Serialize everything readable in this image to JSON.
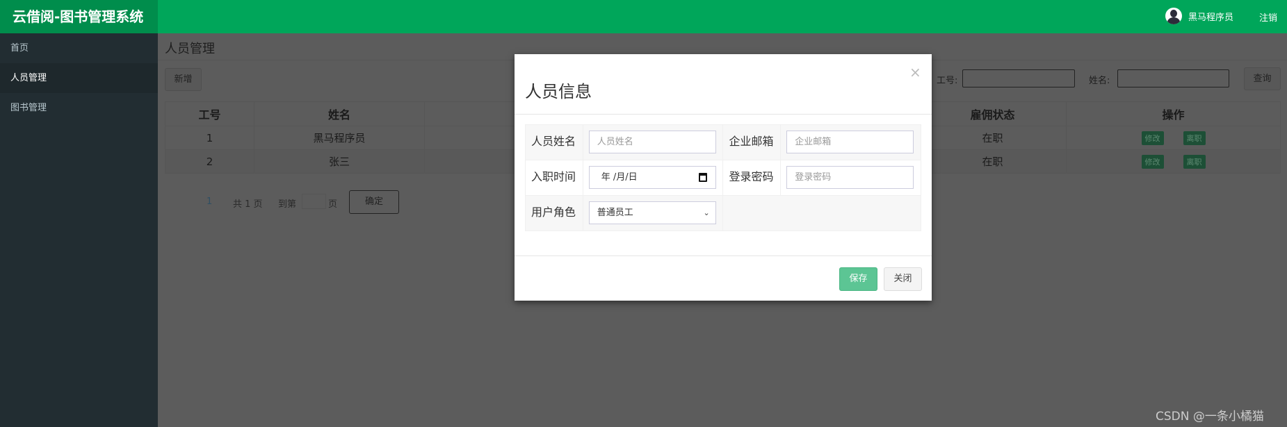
{
  "header": {
    "logo": "云借阅-图书管理系统",
    "user_name": "黑马程序员",
    "logout": "注销"
  },
  "sidebar": {
    "items": [
      {
        "label": "首页"
      },
      {
        "label": "人员管理",
        "active": true
      },
      {
        "label": "图书管理"
      }
    ]
  },
  "main": {
    "title": "人员管理",
    "add_button": "新增",
    "search": {
      "id_label": "工号:",
      "id_value": "",
      "name_label": "姓名:",
      "name_value": "",
      "button": "查询"
    },
    "table": {
      "headers": {
        "id": "工号",
        "name": "姓名",
        "status": "雇佣状态",
        "actions": "操作"
      },
      "rows": [
        {
          "id": "1",
          "name": "黑马程序员",
          "status": "在职",
          "edit": "修改",
          "leave": "离职"
        },
        {
          "id": "2",
          "name": "张三",
          "status": "在职",
          "edit": "修改",
          "leave": "离职"
        }
      ]
    },
    "pagination": {
      "current": "1",
      "total": "共 1 页",
      "goto_prefix": "到第",
      "goto_suffix": "页",
      "confirm": "确定"
    }
  },
  "modal": {
    "title": "人员信息",
    "close": "×",
    "fields": {
      "name_label": "人员姓名",
      "name_placeholder": "人员姓名",
      "email_label": "企业邮箱",
      "email_placeholder": "企业邮箱",
      "date_label": "入职时间",
      "date_value": "年 /月/日",
      "password_label": "登录密码",
      "password_placeholder": "登录密码",
      "role_label": "用户角色",
      "role_value": "普通员工"
    },
    "save": "保存",
    "close_button": "关闭"
  },
  "watermark": "CSDN @一条小橘猫",
  "colors": {
    "header": "#00a65a",
    "logo_bg": "#008d4c",
    "sidebar": "#222d32",
    "save": "#5cc594"
  }
}
